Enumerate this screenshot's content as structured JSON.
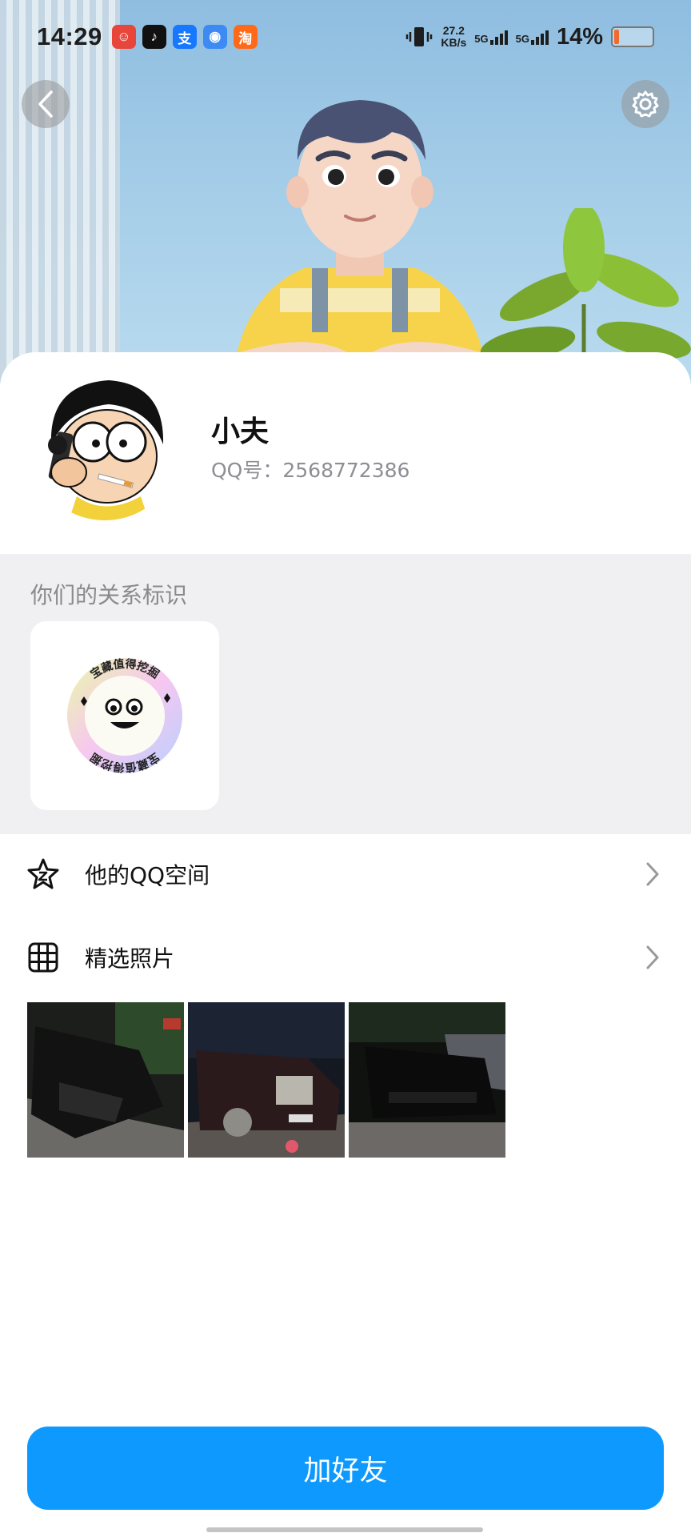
{
  "status_bar": {
    "time": "14:29",
    "net_speed_value": "27.2",
    "net_speed_unit": "KB/s",
    "sim1_label": "5G",
    "sim2_label": "5G",
    "battery_percent": "14%",
    "battery_level": 0.14,
    "notification_apps": [
      {
        "icon": "clown-app-icon",
        "color": "#e8463a"
      },
      {
        "icon": "tiktok-icon",
        "color": "#111111"
      },
      {
        "icon": "alipay-icon",
        "color": "#1677ff"
      },
      {
        "icon": "pill-app-icon",
        "color": "#3d8bf2"
      },
      {
        "icon": "taobao-icon",
        "color": "#ff6a1a"
      }
    ]
  },
  "header": {
    "back_icon": "chevron-left-icon",
    "settings_icon": "gear-icon"
  },
  "profile": {
    "name": "小夫",
    "qq_number": "QQ号：2568772386"
  },
  "relation": {
    "title": "你们的关系标识",
    "badge_text_top": "宝藏值得挖掘",
    "badge_text_bottom": "宝藏值得挖掘"
  },
  "menu": {
    "qzone_label": "他的QQ空间",
    "qzone_icon": "star-icon",
    "photos_label": "精选照片",
    "photos_icon": "grid-icon"
  },
  "photos": [
    {
      "subject": "black-car-front"
    },
    {
      "subject": "rolls-royce-car"
    },
    {
      "subject": "black-camaro"
    }
  ],
  "actions": {
    "add_friend_label": "加好友",
    "accent_color": "#0e99ff"
  }
}
